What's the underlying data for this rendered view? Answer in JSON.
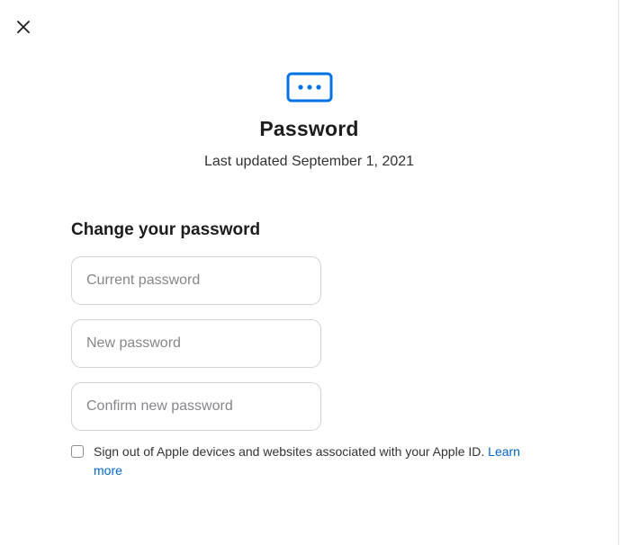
{
  "dialog": {
    "close_icon": "close-icon",
    "header_icon": "password-dots-icon",
    "accent_color": "#0071e3",
    "title": "Password",
    "subtitle": "Last updated September 1, 2021"
  },
  "form": {
    "section_title": "Change your password",
    "current_password_placeholder": "Current password",
    "new_password_placeholder": "New password",
    "confirm_password_placeholder": "Confirm new password",
    "current_password_value": "",
    "new_password_value": "",
    "confirm_password_value": "",
    "signout_checked": false,
    "signout_label": "Sign out of Apple devices and websites associated with your Apple ID.",
    "learn_more_label": "Learn more"
  }
}
